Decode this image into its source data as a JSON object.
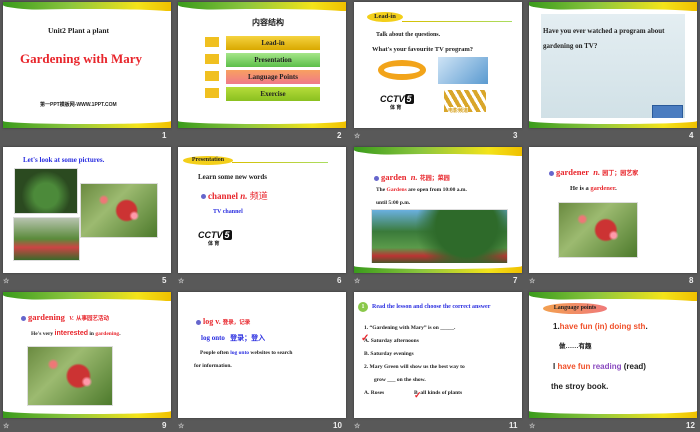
{
  "slides": [
    {
      "num": "1",
      "subtitle": "Unit2 Plant a plant",
      "title": "Gardening with Mary",
      "footer": "第一PPT模板网-WWW.1PPT.COM"
    },
    {
      "num": "2",
      "heading": "内容结构",
      "menu": [
        "Lead-in",
        "Presentation",
        "Language Points",
        "Exercise"
      ]
    },
    {
      "num": "3",
      "tag": "Lead-in",
      "line1": "Talk about  the questions.",
      "line2": "What's your  favourite  TV  program?",
      "cctv": "CCTV",
      "cctv_num": "5",
      "cctv_sub": "体 育",
      "movie": "电影频道"
    },
    {
      "num": "4",
      "question": "Have you ever watched a program about gardening on TV?"
    },
    {
      "num": "5",
      "heading": "Let's look at some pictures."
    },
    {
      "num": "6",
      "tag": "Presentation",
      "line1": "Learn some new words",
      "word": "channel",
      "pos": "n.",
      "meaning": "频道",
      "example": "TV  channel",
      "cctv": "CCTV",
      "cctv_num": "5",
      "cctv_sub": "体 育"
    },
    {
      "num": "7",
      "word": "garden",
      "pos": "n.",
      "meaning": "花园；菜园",
      "s1": "The ",
      "s_hl": "Gardens",
      "s2": " are open from 10:00 a.m.",
      "s3": "until 5:00 p.m."
    },
    {
      "num": "8",
      "word": "gardener",
      "pos": "n.",
      "meaning": "园丁；园艺家",
      "s1": "He is a ",
      "s_hl": "gardener",
      "s2": "."
    },
    {
      "num": "9",
      "word": "gardening",
      "pos": "V.",
      "meaning": "从事园艺活动",
      "s1": "He's very ",
      "s_hl": "interested",
      "s2": " in ",
      "s_hl2": "gardening",
      "s3": "."
    },
    {
      "num": "10",
      "word": "log",
      "pos": "v.",
      "meaning": "登录，记录",
      "phrase": "log onto",
      "phrase_meaning": "登录；登入",
      "s1": "People  often  ",
      "s_hl": "log onto",
      "s2": " websites  to search",
      "s3": "for information."
    },
    {
      "num": "11",
      "badge": "1",
      "heading": "Read the lesson and choose the correct answer",
      "q1": "1.  “Gardening  with  Mary”  is on _____.",
      "a1": "A. Saturday  afternoons",
      "b1": "B.  Saturday  evenings",
      "q2": "2. Mary  Green will show  us the best way  to",
      "q2b": "grow  ___ on  the show.",
      "a2": "A.  Roses",
      "b2": "B. all kinds of plants"
    },
    {
      "num": "12",
      "tag": "Language points",
      "p1": "1.",
      "p1_hl": "have fun (in) doing  sth",
      "p1_end": ".",
      "p1_cn": "做……有趣",
      "s1": "I ",
      "s_hl": "have fun",
      "s_hl2": "reading",
      "s2": "  (read)",
      "s3": "the stroy book."
    }
  ],
  "colors": {
    "red": "#e8262c",
    "blue": "#2a2ee0",
    "background": "#595959"
  }
}
